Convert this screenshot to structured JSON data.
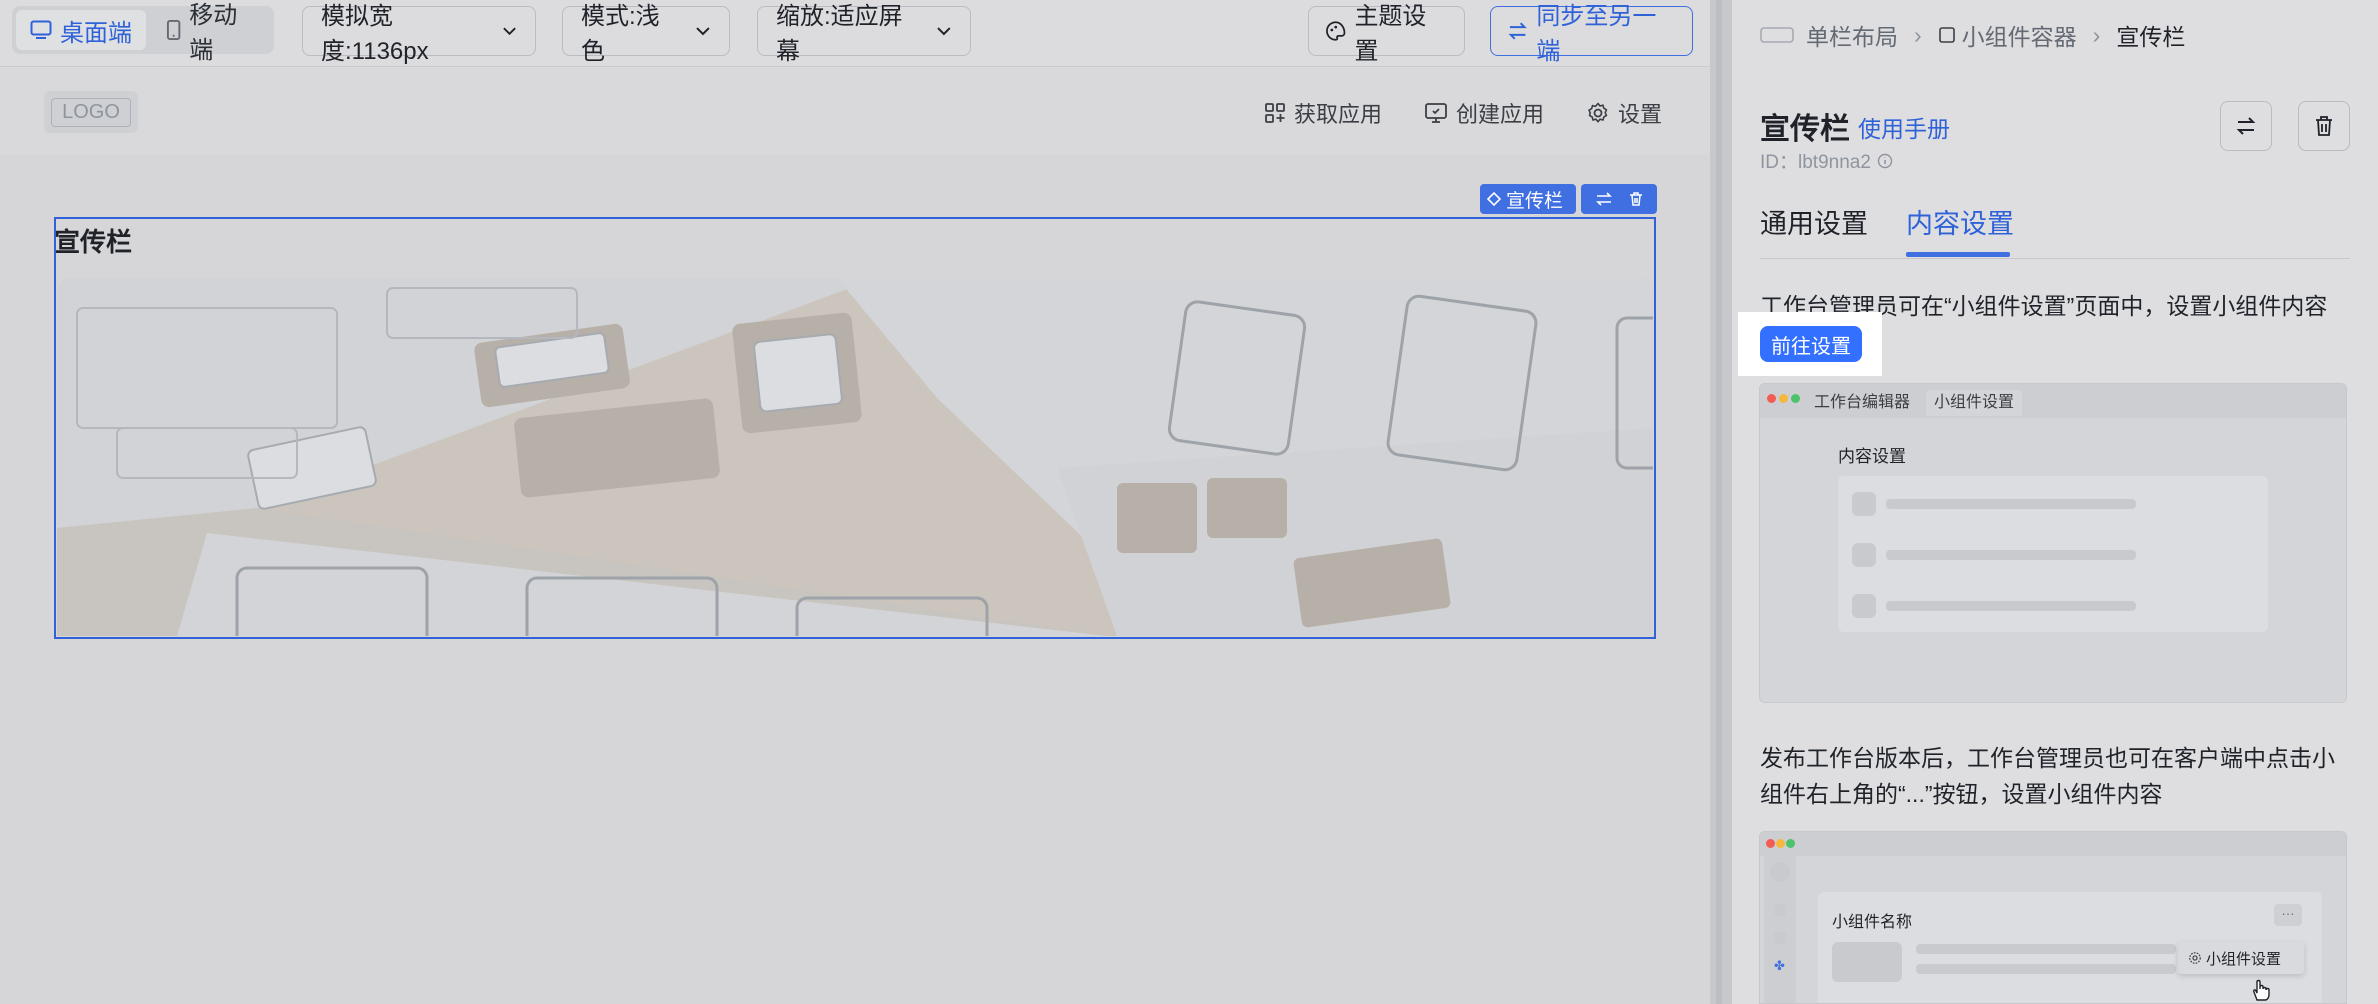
{
  "toolbar": {
    "segment": {
      "desktop": "桌面端",
      "mobile": "移动端"
    },
    "width_select": "模拟宽度:1136px",
    "mode_select": "模式:浅色",
    "zoom_select": "缩放:适应屏幕",
    "theme_button": "主题设置",
    "sync_button": "同步至另一端"
  },
  "canvas": {
    "logo": "LOGO",
    "nav": {
      "get_app": "获取应用",
      "create_app": "创建应用",
      "settings": "设置"
    },
    "widget": {
      "title": "宣传栏",
      "tag_label": "宣传栏"
    }
  },
  "panel": {
    "breadcrumb": [
      "单栏布局",
      "小组件容器",
      "宣传栏"
    ],
    "title": "宣传栏",
    "manual_link": "使用手册",
    "id_text": "ID：lbt9nna2",
    "tabs": {
      "general": "通用设置",
      "content": "内容设置"
    },
    "desc1": "工作台管理员可在“小组件设置”页面中，设置小组件内容",
    "goto_button": "前往设置",
    "preview1": {
      "tab1": "工作台编辑器",
      "tab2": "小组件设置",
      "heading": "内容设置"
    },
    "desc2": "发布工作台版本后，工作台管理员也可在客户端中点击小组件右上角的“...”按钮，设置小组件内容",
    "preview2": {
      "widget_name": "小组件名称",
      "menu_item": "小组件设置",
      "more": "···"
    }
  },
  "colors": {
    "accent": "#2f62d9",
    "button_blue": "#3370ff",
    "overlay_bg": "#d9d9db"
  }
}
